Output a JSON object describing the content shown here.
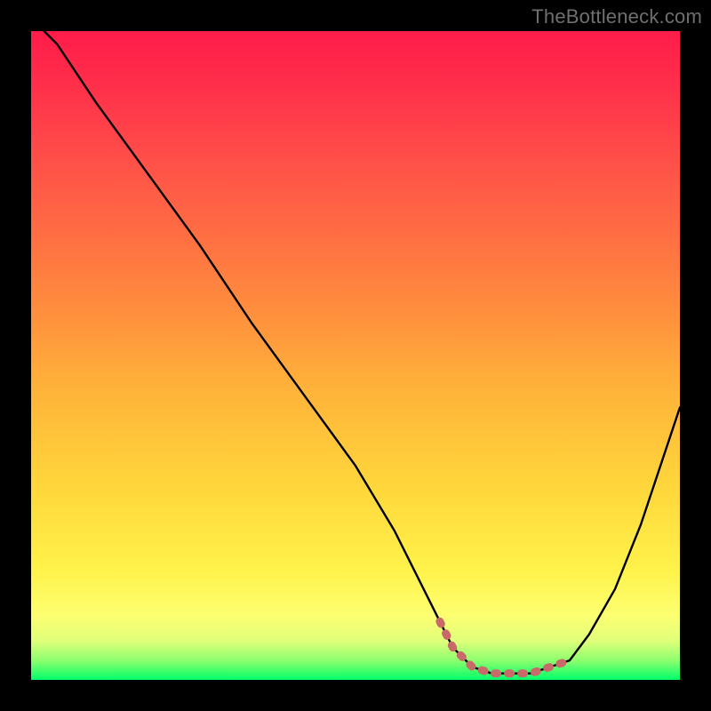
{
  "attribution": "TheBottleneck.com",
  "chart_data": {
    "type": "line",
    "title": "",
    "xlabel": "",
    "ylabel": "",
    "xlim": [
      0,
      100
    ],
    "ylim": [
      0,
      100
    ],
    "x": [
      0,
      4,
      10,
      18,
      26,
      34,
      42,
      50,
      56,
      60,
      63,
      65,
      68,
      71,
      74,
      77,
      80,
      83,
      86,
      90,
      94,
      100
    ],
    "values": [
      102,
      98,
      89,
      78,
      67,
      55,
      44,
      33,
      23,
      15,
      9,
      5,
      2,
      1,
      1,
      1,
      2,
      3,
      7,
      14,
      24,
      42
    ],
    "gradient_stops": [
      {
        "pos": 0.0,
        "color": "#ff1c4a"
      },
      {
        "pos": 0.08,
        "color": "#ff2e4a"
      },
      {
        "pos": 0.18,
        "color": "#ff4a49"
      },
      {
        "pos": 0.3,
        "color": "#ff6a44"
      },
      {
        "pos": 0.42,
        "color": "#ff8b3e"
      },
      {
        "pos": 0.55,
        "color": "#ffb23a"
      },
      {
        "pos": 0.7,
        "color": "#ffd63b"
      },
      {
        "pos": 0.83,
        "color": "#fff24a"
      },
      {
        "pos": 0.9,
        "color": "#fdff71"
      },
      {
        "pos": 0.94,
        "color": "#e0ff7a"
      },
      {
        "pos": 0.97,
        "color": "#8dff6e"
      },
      {
        "pos": 1.0,
        "color": "#00ff6a"
      }
    ],
    "trough_marker": {
      "color": "#c96a6a",
      "x_range": [
        63,
        83
      ],
      "y": 1
    }
  }
}
